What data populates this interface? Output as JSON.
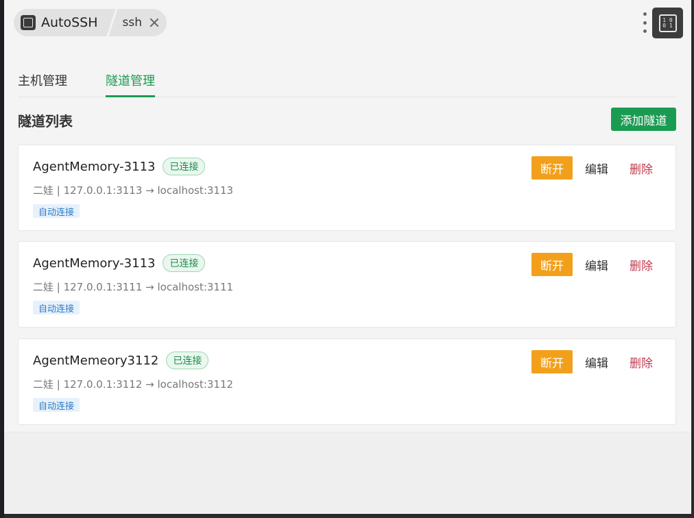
{
  "header": {
    "app_name": "AutoSSH",
    "active_tab": "ssh"
  },
  "nav_tabs": [
    "主机管理",
    "隧道管理"
  ],
  "section": {
    "title": "隧道列表",
    "add_label": "添加隧道"
  },
  "tunnels": [
    {
      "name": "AgentMemory-3113",
      "status": "已连接",
      "detail": "二娃 | 127.0.0.1:3113 → localhost:3113",
      "tag": "自动连接",
      "disconnect_label": "断开",
      "edit_label": "编辑",
      "delete_label": "删除"
    },
    {
      "name": "AgentMemory-3113",
      "status": "已连接",
      "detail": "二娃 | 127.0.0.1:3111 → localhost:3111",
      "tag": "自动连接",
      "disconnect_label": "断开",
      "edit_label": "编辑",
      "delete_label": "删除"
    },
    {
      "name": "AgentMemeory3112",
      "status": "已连接",
      "detail": "二娃 | 127.0.0.1:3112 → localhost:3112",
      "tag": "自动连接",
      "disconnect_label": "断开",
      "edit_label": "编辑",
      "delete_label": "删除"
    }
  ],
  "colors": {
    "accent": "#1a9b52",
    "warning": "#f2a01c",
    "danger": "#c03a4f",
    "tag_blue": "#2d7ac6"
  },
  "icons": {
    "app_logo": "terminal-icon",
    "close": "close-icon",
    "menu": "more-vertical-icon",
    "corner": "binary-icon"
  }
}
